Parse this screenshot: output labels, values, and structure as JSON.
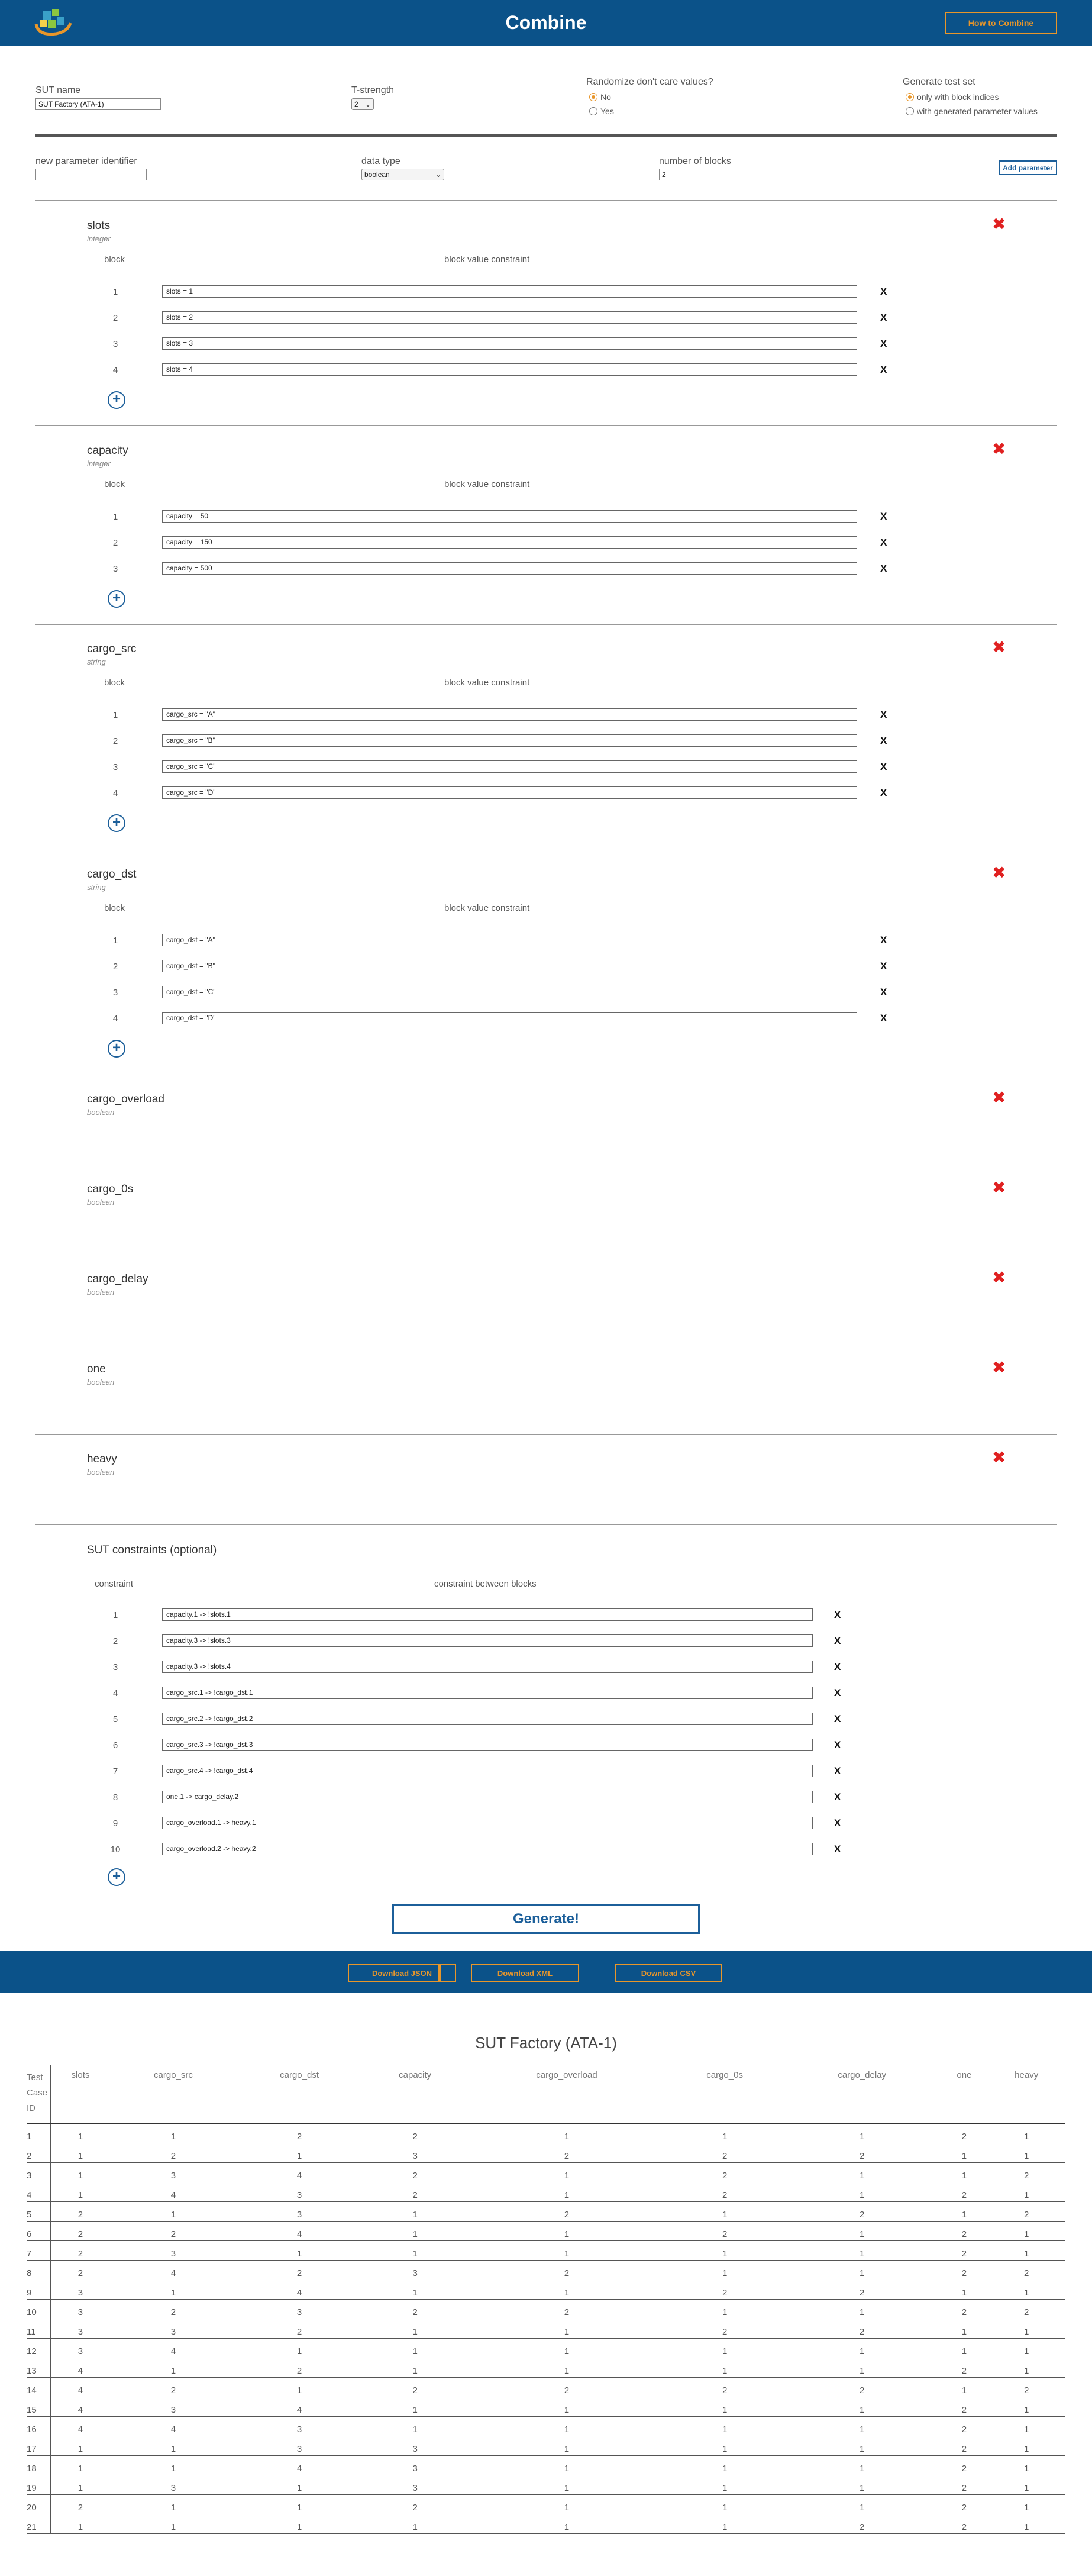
{
  "header": {
    "title": "Combine",
    "how_to_label": "How to Combine"
  },
  "settings": {
    "sut_name_label": "SUT name",
    "sut_name_value": "SUT Factory (ATA-1)",
    "t_strength_label": "T-strength",
    "t_strength_value": "2",
    "randomize_label": "Randomize don't care values?",
    "randomize_no": "No",
    "randomize_yes": "Yes",
    "generate_label": "Generate test set",
    "generate_opt1": "only with block indices",
    "generate_opt2": "with generated parameter values"
  },
  "new_param": {
    "id_label": "new parameter identifier",
    "id_value": "",
    "type_label": "data type",
    "type_value": "boolean",
    "blocks_label": "number of blocks",
    "blocks_value": "2",
    "add_label": "Add parameter"
  },
  "column_headers": {
    "block": "block",
    "block_value_constraint": "block value constraint",
    "constraint": "constraint",
    "constraint_between_blocks": "constraint between blocks"
  },
  "parameters": [
    {
      "name": "slots",
      "type": "integer",
      "blocks": [
        "slots = 1",
        "slots = 2",
        "slots = 3",
        "slots = 4"
      ]
    },
    {
      "name": "capacity",
      "type": "integer",
      "blocks": [
        "capacity = 50",
        "capacity = 150",
        "capacity = 500"
      ]
    },
    {
      "name": "cargo_src",
      "type": "string",
      "blocks": [
        "cargo_src = \"A\"",
        "cargo_src = \"B\"",
        "cargo_src = \"C\"",
        "cargo_src = \"D\""
      ]
    },
    {
      "name": "cargo_dst",
      "type": "string",
      "blocks": [
        "cargo_dst = \"A\"",
        "cargo_dst = \"B\"",
        "cargo_dst = \"C\"",
        "cargo_dst = \"D\""
      ]
    },
    {
      "name": "cargo_overload",
      "type": "boolean",
      "blocks": []
    },
    {
      "name": "cargo_0s",
      "type": "boolean",
      "blocks": []
    },
    {
      "name": "cargo_delay",
      "type": "boolean",
      "blocks": []
    },
    {
      "name": "one",
      "type": "boolean",
      "blocks": []
    },
    {
      "name": "heavy",
      "type": "boolean",
      "blocks": []
    }
  ],
  "sut_constraints": {
    "title": "SUT constraints (optional)",
    "items": [
      "capacity.1 -> !slots.1",
      "capacity.3 -> !slots.3",
      "capacity.3 -> !slots.4",
      "cargo_src.1 -> !cargo_dst.1",
      "cargo_src.2 -> !cargo_dst.2",
      "cargo_src.3 -> !cargo_dst.3",
      "cargo_src.4 -> !cargo_dst.4",
      "one.1 -> cargo_delay.2",
      "cargo_overload.1 -> heavy.1",
      "cargo_overload.2 -> heavy.2"
    ]
  },
  "delete_symbol": "X",
  "generate_label": "Generate!",
  "downloads": [
    "Download JSON",
    "Download XML",
    "Download CSV"
  ],
  "results": {
    "title": "SUT Factory (ATA-1)",
    "first_header": "Test Case ID",
    "headers": [
      "slots",
      "cargo_src",
      "cargo_dst",
      "capacity",
      "cargo_overload",
      "cargo_0s",
      "cargo_delay",
      "one",
      "heavy"
    ],
    "rows": [
      [
        "1",
        "1",
        "1",
        "2",
        "2",
        "1",
        "1",
        "1",
        "2",
        "1"
      ],
      [
        "2",
        "1",
        "2",
        "1",
        "3",
        "2",
        "2",
        "2",
        "1",
        "1"
      ],
      [
        "3",
        "1",
        "3",
        "4",
        "2",
        "1",
        "2",
        "1",
        "1",
        "2"
      ],
      [
        "4",
        "1",
        "4",
        "3",
        "2",
        "1",
        "2",
        "1",
        "2",
        "1"
      ],
      [
        "5",
        "2",
        "1",
        "3",
        "1",
        "2",
        "1",
        "2",
        "1",
        "2"
      ],
      [
        "6",
        "2",
        "2",
        "4",
        "1",
        "1",
        "2",
        "1",
        "2",
        "1"
      ],
      [
        "7",
        "2",
        "3",
        "1",
        "1",
        "1",
        "1",
        "1",
        "2",
        "1"
      ],
      [
        "8",
        "2",
        "4",
        "2",
        "3",
        "2",
        "1",
        "1",
        "2",
        "2"
      ],
      [
        "9",
        "3",
        "1",
        "4",
        "1",
        "1",
        "2",
        "2",
        "1",
        "1"
      ],
      [
        "10",
        "3",
        "2",
        "3",
        "2",
        "2",
        "1",
        "1",
        "2",
        "2"
      ],
      [
        "11",
        "3",
        "3",
        "2",
        "1",
        "1",
        "2",
        "2",
        "1",
        "1"
      ],
      [
        "12",
        "3",
        "4",
        "1",
        "1",
        "1",
        "1",
        "1",
        "1",
        "1"
      ],
      [
        "13",
        "4",
        "1",
        "2",
        "1",
        "1",
        "1",
        "1",
        "2",
        "1"
      ],
      [
        "14",
        "4",
        "2",
        "1",
        "2",
        "2",
        "2",
        "2",
        "1",
        "2"
      ],
      [
        "15",
        "4",
        "3",
        "4",
        "1",
        "1",
        "1",
        "1",
        "2",
        "1"
      ],
      [
        "16",
        "4",
        "4",
        "3",
        "1",
        "1",
        "1",
        "1",
        "2",
        "1"
      ],
      [
        "17",
        "1",
        "1",
        "3",
        "3",
        "1",
        "1",
        "1",
        "2",
        "1"
      ],
      [
        "18",
        "1",
        "1",
        "4",
        "3",
        "1",
        "1",
        "1",
        "2",
        "1"
      ],
      [
        "19",
        "1",
        "3",
        "1",
        "3",
        "1",
        "1",
        "1",
        "2",
        "1"
      ],
      [
        "20",
        "2",
        "1",
        "1",
        "2",
        "1",
        "1",
        "1",
        "2",
        "1"
      ],
      [
        "21",
        "1",
        "1",
        "1",
        "1",
        "1",
        "1",
        "2",
        "2",
        "1"
      ]
    ]
  },
  "colors": {
    "header_bg": "#0b5289",
    "accent_orange": "#e8962a",
    "button_blue": "#1c5f9a",
    "delete_red": "#e02020"
  }
}
